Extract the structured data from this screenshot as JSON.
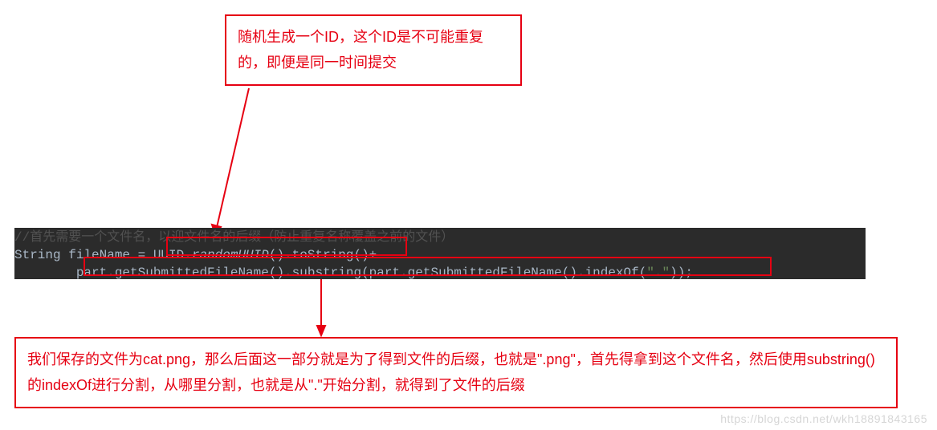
{
  "annotations": {
    "top": "随机生成一个ID，这个ID是不可能重复的，即便是同一时间提交",
    "bottom": "我们保存的文件为cat.png，那么后面这一部分就是为了得到文件的后缀，也就是\".png\"，首先得拿到这个文件名，然后使用substring()的indexOf进行分割，从哪里分割，也就是从\".\"开始分割，就得到了文件的后缀"
  },
  "code": {
    "comment_partial_top": "//首先需要一个文件名，以迎文件名的后缀（防止重复名称覆盖之前的文件）",
    "prefix": "String fileName = ",
    "seg1_class": "UUID",
    "seg1_dot": ".",
    "seg1_method": "randomUUID",
    "seg1_rest": "().toString()+",
    "line2_lead": "        part.getSubmittedFileName().substring(part.getSubmittedFileName().indexOf(",
    "line2_str": "\".\"",
    "line2_tail": "));"
  },
  "watermark": "https://blog.csdn.net/wkh18891843165"
}
